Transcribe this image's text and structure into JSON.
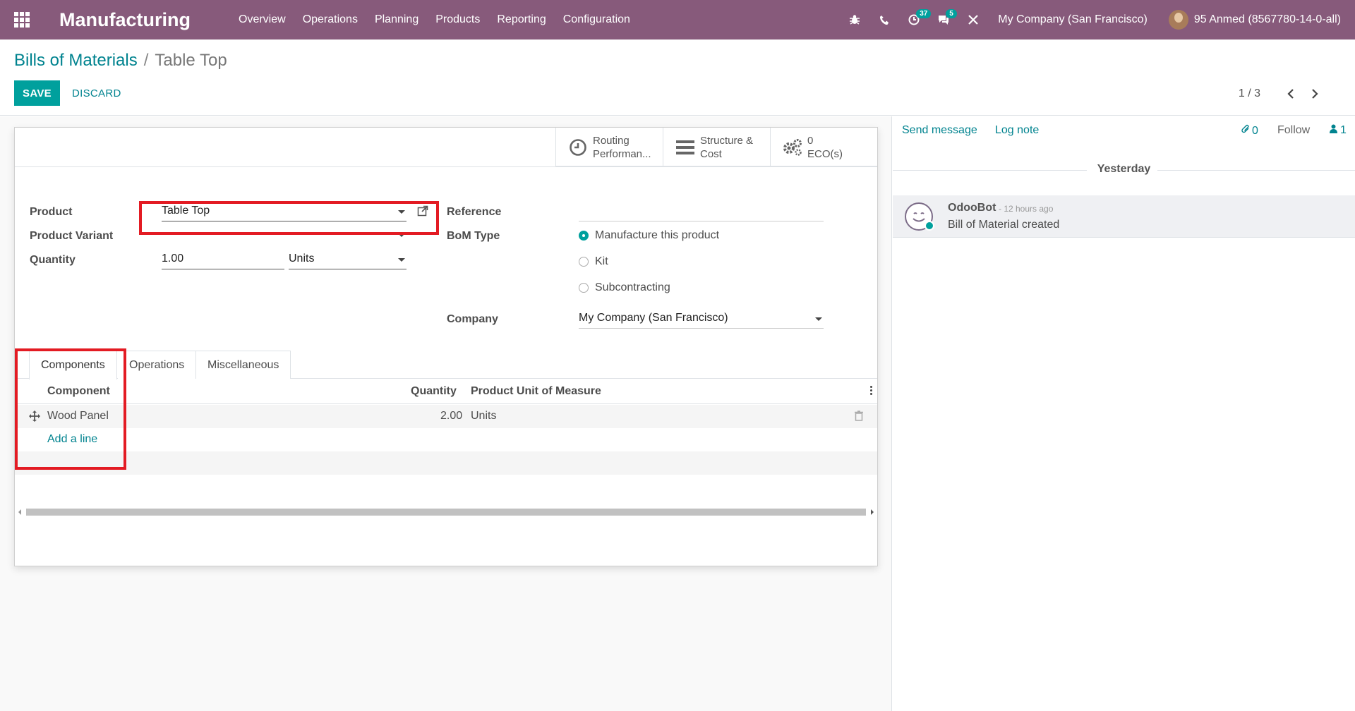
{
  "navbar": {
    "app_title": "Manufacturing",
    "menu": [
      "Overview",
      "Operations",
      "Planning",
      "Products",
      "Reporting",
      "Configuration"
    ],
    "activity_count": "37",
    "message_count": "5",
    "company": "My Company (San Francisco)",
    "user": "95 Anmed (8567780-14-0-all)",
    "brand_color": "#875a7b"
  },
  "control_panel": {
    "breadcrumb_parent": "Bills of Materials",
    "breadcrumb_separator": "/",
    "breadcrumb_current": "Table Top",
    "save_label": "SAVE",
    "discard_label": "DISCARD",
    "pager_value": "1 / 3"
  },
  "button_box": {
    "routing": {
      "line1": "Routing",
      "line2": "Performan..."
    },
    "structure": {
      "line1": "Structure &",
      "line2": "Cost"
    },
    "eco": {
      "line1": "0",
      "line2": "ECO(s)"
    }
  },
  "form": {
    "product_label": "Product",
    "product_value": "Table Top",
    "variant_label": "Product Variant",
    "variant_value": "",
    "quantity_label": "Quantity",
    "quantity_value": "1.00",
    "uom_value": "Units",
    "reference_label": "Reference",
    "reference_value": "",
    "bom_type_label": "BoM Type",
    "bom_types": [
      "Manufacture this product",
      "Kit",
      "Subcontracting"
    ],
    "bom_type_selected": "Manufacture this product",
    "company_label": "Company",
    "company_value": "My Company (San Francisco)"
  },
  "tabs": [
    "Components",
    "Operations",
    "Miscellaneous"
  ],
  "components_table": {
    "headers": [
      "Component",
      "Quantity",
      "Product Unit of Measure"
    ],
    "rows": [
      {
        "component": "Wood Panel",
        "quantity": "2.00",
        "uom": "Units"
      }
    ],
    "add_line_label": "Add a line"
  },
  "chatter": {
    "send_message": "Send message",
    "log_note": "Log note",
    "attachments_count": "0",
    "follow_label": "Follow",
    "followers_count": "1",
    "day_label": "Yesterday",
    "messages": [
      {
        "author": "OdooBot",
        "time": "- 12 hours ago",
        "body": "Bill of Material created"
      }
    ]
  },
  "accent_color": "#00a09d",
  "highlight_color": "#e31b23"
}
